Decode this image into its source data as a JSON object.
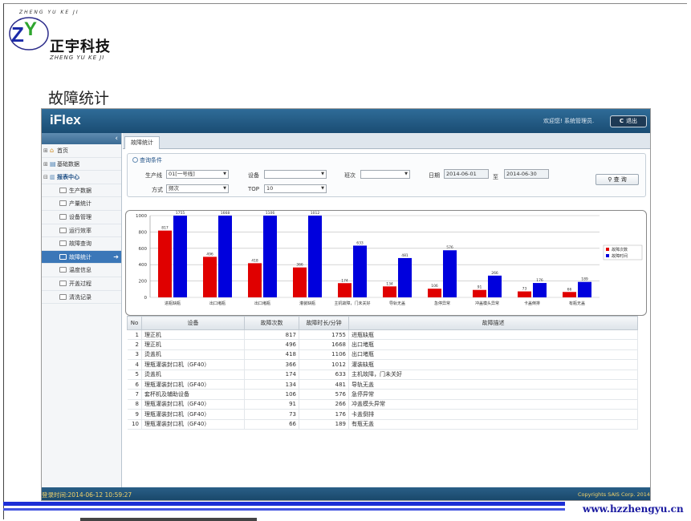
{
  "slide": {
    "title": "故障统计",
    "logo_text_cn": "正宇科技",
    "logo_text_en": "ZHENG YU KE JI",
    "website": "www.hzzhengyu.cn"
  },
  "app": {
    "brand": "iFlex",
    "welcome": "欢迎您! 系统管理员.",
    "logout_label": "退出",
    "status_time": "登录时间:2014-06-12 10:59:27",
    "copyright": "Copyrights SAIS Corp. 2014"
  },
  "sidebar": {
    "top_items": [
      {
        "label": "首页"
      },
      {
        "label": "基础数据"
      }
    ],
    "group_label": "报表中心",
    "sub_items": [
      {
        "label": "生产数据",
        "active": false
      },
      {
        "label": "产量统计",
        "active": false
      },
      {
        "label": "设备管理",
        "active": false
      },
      {
        "label": "运行效率",
        "active": false
      },
      {
        "label": "故障查询",
        "active": false
      },
      {
        "label": "故障统计",
        "active": true
      },
      {
        "label": "温度信息",
        "active": false
      },
      {
        "label": "开盖过程",
        "active": false
      },
      {
        "label": "清洗记录",
        "active": false
      }
    ]
  },
  "tabs": {
    "active_label": "故障统计"
  },
  "query": {
    "panel_title": "查询条件",
    "line_label": "生产线",
    "line_value": "01[一号线]",
    "equipment_label": "设备",
    "equipment_value": "",
    "shift_label": "班次",
    "shift_value": "",
    "date_label": "日期",
    "date_from": "2014-06-01",
    "date_to_label": "至",
    "date_to": "2014-06-30",
    "mode_label": "方式",
    "mode_value": "频次",
    "top_label": "TOP",
    "top_value": "10",
    "search_label": "查 询"
  },
  "chart_data": {
    "type": "bar",
    "categories": [
      "进瓶缺瓶",
      "出口堵瓶",
      "出口堵瓶",
      "灌装缺瓶",
      "主机故障，门未关好",
      "导轨无盖",
      "急停异常",
      "冲盖模头异常",
      "卡盖倒排",
      "有瓶无盖"
    ],
    "series": [
      {
        "name": "故障次数",
        "color": "#e00000",
        "values": [
          817,
          496,
          418,
          366,
          174,
          134,
          106,
          91,
          73,
          66
        ]
      },
      {
        "name": "故障时间",
        "color": "#0000dd",
        "values": [
          1755,
          1668,
          1106,
          1012,
          633,
          481,
          576,
          266,
          176,
          189
        ]
      }
    ],
    "ylim": [
      0,
      1000
    ],
    "yticks": [
      0,
      200,
      400,
      600,
      800,
      1000
    ],
    "grid": true,
    "legend": "right"
  },
  "table": {
    "headers": [
      "No",
      "设备",
      "故障次数",
      "故障时长/分钟",
      "故障描述"
    ],
    "rows": [
      {
        "no": "1",
        "device": "理正机",
        "count": "817",
        "duration": "1755",
        "desc": "进瓶缺瓶"
      },
      {
        "no": "2",
        "device": "理正机",
        "count": "496",
        "duration": "1668",
        "desc": "出口堵瓶"
      },
      {
        "no": "3",
        "device": "烫盖机",
        "count": "418",
        "duration": "1106",
        "desc": "出口堵瓶"
      },
      {
        "no": "4",
        "device": "理瓶灌装封口机（GF40）",
        "count": "366",
        "duration": "1012",
        "desc": "灌装缺瓶"
      },
      {
        "no": "5",
        "device": "烫盖机",
        "count": "174",
        "duration": "633",
        "desc": "主机故障，门未关好"
      },
      {
        "no": "6",
        "device": "理瓶灌装封口机（GF40）",
        "count": "134",
        "duration": "481",
        "desc": "导轨无盖"
      },
      {
        "no": "7",
        "device": "套杯机及辅助设备",
        "count": "106",
        "duration": "576",
        "desc": "急停异常"
      },
      {
        "no": "8",
        "device": "理瓶灌装封口机（GF40）",
        "count": "91",
        "duration": "266",
        "desc": "冲盖模头异常"
      },
      {
        "no": "9",
        "device": "理瓶灌装封口机（GF40）",
        "count": "73",
        "duration": "176",
        "desc": "卡盖倒排"
      },
      {
        "no": "10",
        "device": "理瓶灌装封口机（GF40）",
        "count": "66",
        "duration": "189",
        "desc": "有瓶无盖"
      }
    ]
  }
}
